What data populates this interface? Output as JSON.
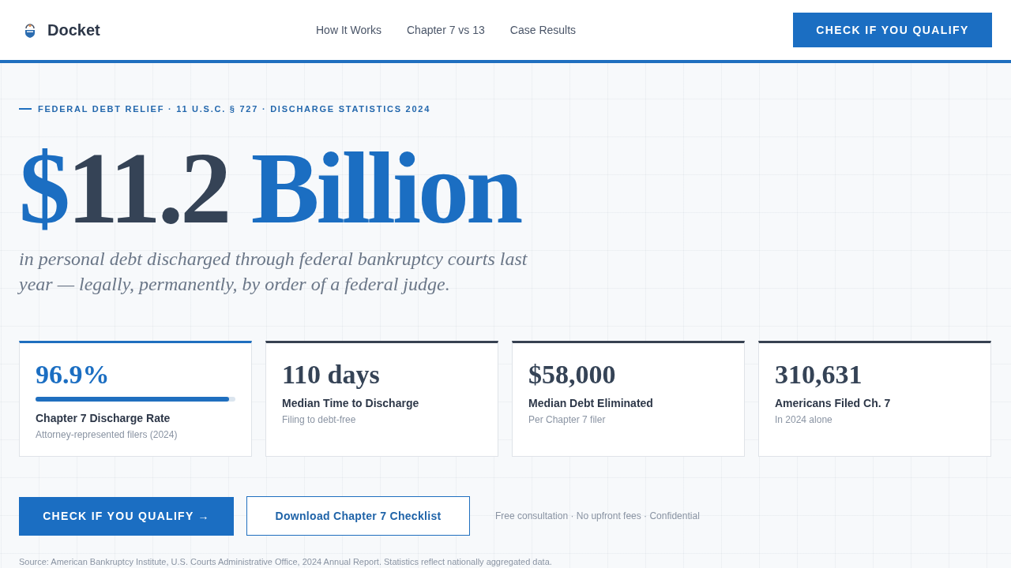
{
  "nav": {
    "brand": "Docket",
    "links": [
      "How It Works",
      "Chapter 7 vs 13",
      "Case Results"
    ],
    "cta": "CHECK IF YOU QUALIFY"
  },
  "hero": {
    "eyebrow": "FEDERAL DEBT RELIEF · 11 U.S.C. § 727 · DISCHARGE STATISTICS 2024",
    "headline": [
      {
        "text": "$",
        "accent": true
      },
      {
        "text": "11.2",
        "accent": false
      },
      {
        "text": " Billion",
        "accent": true
      }
    ],
    "subtitle": "in personal debt discharged through federal bankruptcy courts last year — legally, permanently, by order of a federal judge."
  },
  "stats": [
    {
      "value": "96.9%",
      "label": "Chapter 7 Discharge Rate",
      "note": "Attorney-represented filers (2024)",
      "highlighted": true,
      "level": 0.969
    },
    {
      "value": "110 days",
      "label": "Median Time to Discharge",
      "note": "Filing to debt-free",
      "highlighted": false
    },
    {
      "value": "$58,000",
      "label": "Median Debt Eliminated",
      "note": "Per Chapter 7 filer",
      "highlighted": false
    },
    {
      "value": "310,631",
      "label": "Americans Filed Ch. 7",
      "note": "In 2024 alone",
      "highlighted": false
    }
  ],
  "actions": {
    "primary": "CHECK IF YOU QUALIFY →",
    "secondary": "Download Chapter 7 Checklist",
    "note": "Free consultation · No upfront fees · Confidential"
  },
  "source": "Source: American Bankruptcy Institute, U.S. Courts Administrative Office, 2024 Annual Report. Statistics reflect nationally aggregated data."
}
